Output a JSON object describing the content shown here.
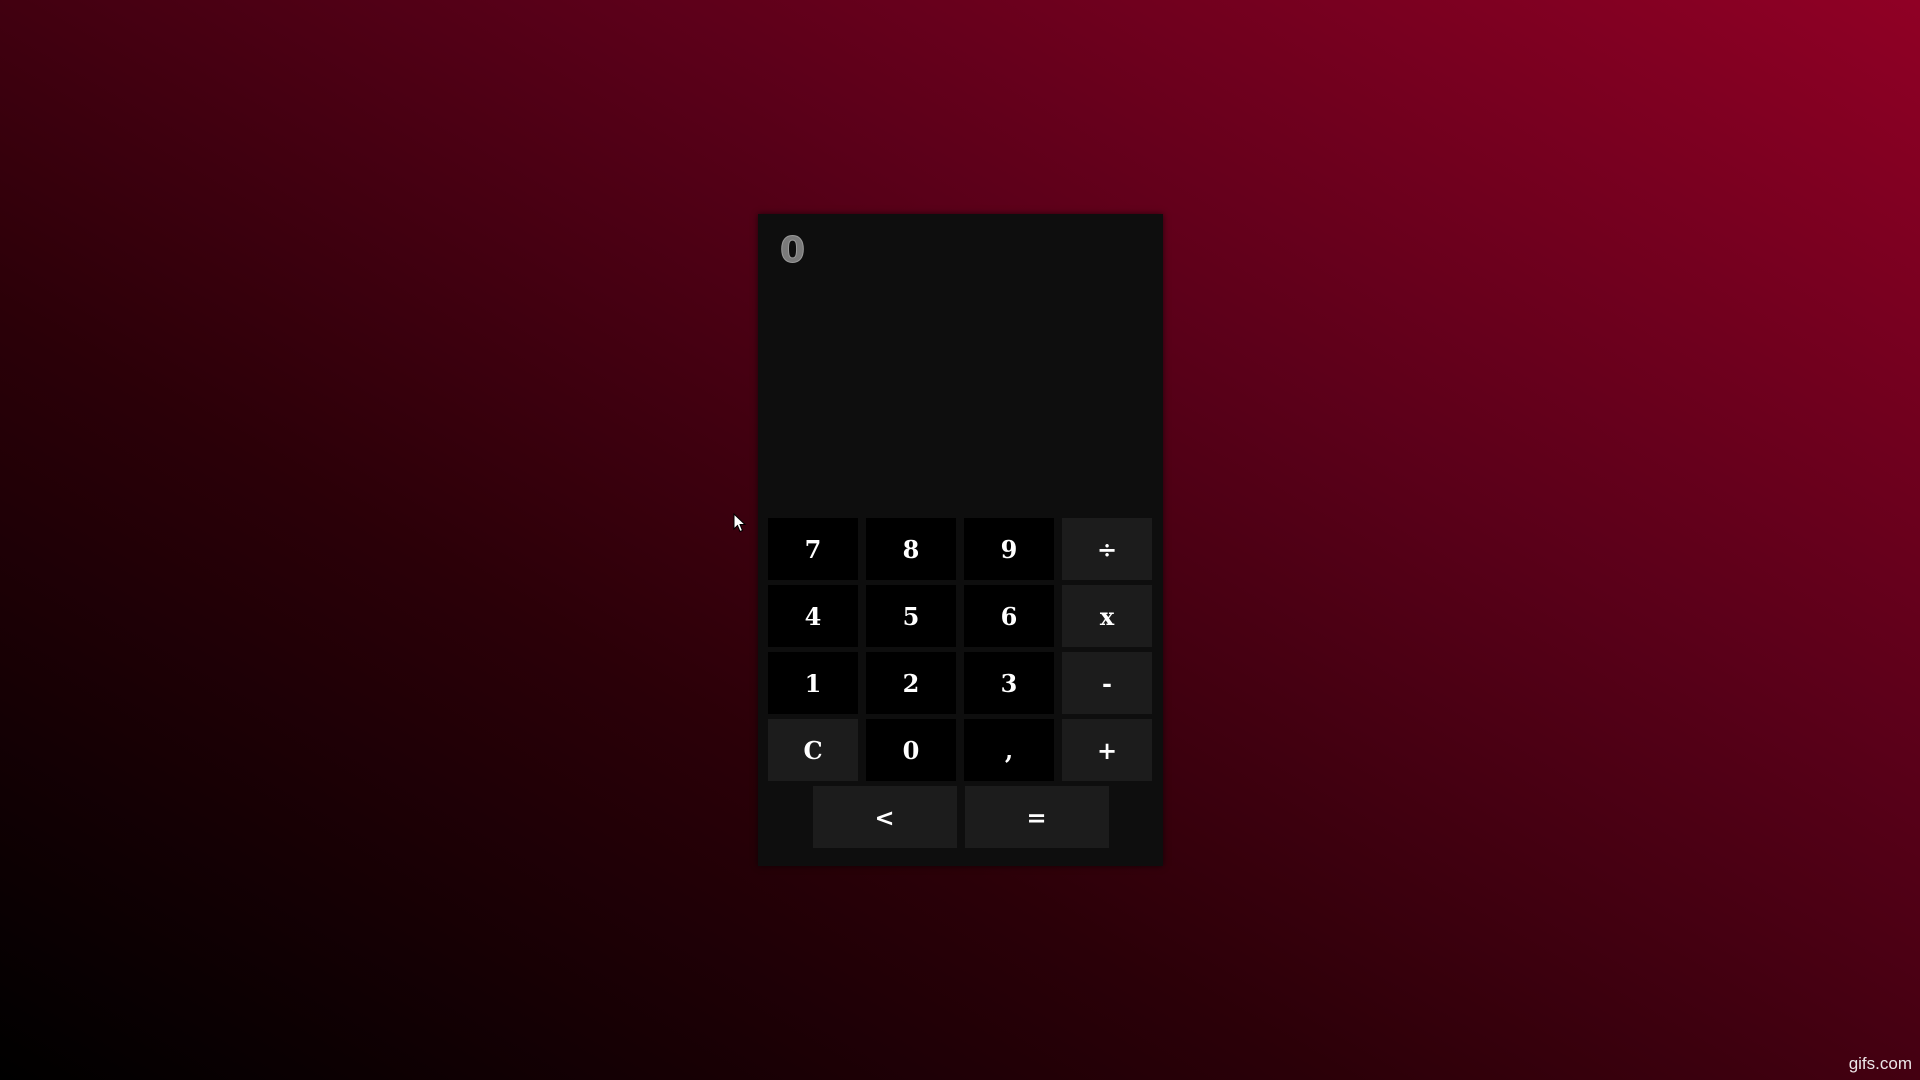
{
  "display": {
    "value": "0"
  },
  "keypad": {
    "rows": [
      [
        "7",
        "8",
        "9",
        "÷"
      ],
      [
        "4",
        "5",
        "6",
        "x"
      ],
      [
        "1",
        "2",
        "3",
        "-"
      ],
      [
        "C",
        "0",
        ",",
        "+"
      ]
    ],
    "backspace": "<",
    "equals": "="
  },
  "watermark": "gifs.com",
  "colors": {
    "calculator_bg": "#0e0e0e",
    "digit_key_bg": "#000000",
    "operator_key_bg": "#1c1c1c",
    "key_text": "#ffffff",
    "display_text": "#7a7a7a",
    "background_start": "#000000",
    "background_end": "#900025"
  },
  "icons": {
    "cursor": "mouse-pointer-icon"
  }
}
